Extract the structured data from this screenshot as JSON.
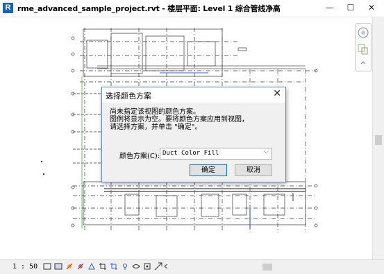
{
  "window": {
    "app_icon_letter": "R",
    "title": "rme_advanced_sample_project.rvt - 楼层平面: Level 1 综合管线净高",
    "minimize": "—",
    "maximize": "☐",
    "close": "✕"
  },
  "dialog": {
    "title": "选择颜色方案",
    "close": "✕",
    "message_lines": [
      "尚未指定该视图的颜色方案。",
      "图例将显示为空。要将颜色方案应用到视图，",
      "请选择方案，并单击 \"确定\"。"
    ],
    "scheme_label": "颜色方案(C):",
    "scheme_value": "Duct Color Fill",
    "ok_label": "确定",
    "cancel_label": "取消"
  },
  "statusbar": {
    "scale": "1 : 50"
  }
}
